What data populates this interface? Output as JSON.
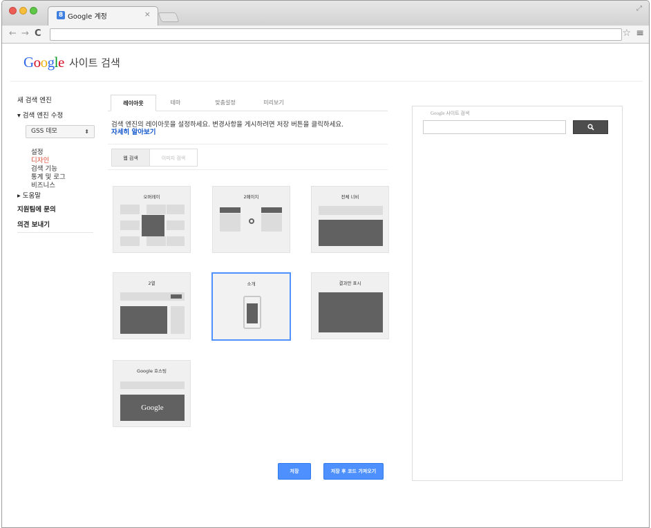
{
  "browser": {
    "tab_title": "Google 계정",
    "tab_close": "×",
    "favicon": "8",
    "url": "",
    "icons": {
      "back": "back-arrow-icon",
      "forward": "forward-arrow-icon",
      "reload": "reload-icon",
      "star": "star-icon",
      "menu": "menu-icon"
    }
  },
  "header": {
    "logo_letters": [
      "G",
      "o",
      "o",
      "g",
      "l",
      "e"
    ],
    "product_title": "사이트 검색"
  },
  "sidebar": {
    "new_engine": "새 검색 엔진",
    "edit_engine": "▾ 검색 엔진 수정",
    "engine_select": "GSS 데모",
    "engine_select_arrows": "⬍",
    "sub_items": [
      "설정",
      "디자인",
      "검색 기능",
      "통계 및 로그",
      "비즈니스"
    ],
    "active_sub": "디자인",
    "help": "▸ 도움말",
    "contact": "지원팀에 문의",
    "feedback": "의견 보내기"
  },
  "tabs": [
    {
      "label": "레이아웃",
      "active": true
    },
    {
      "label": "테마",
      "active": false
    },
    {
      "label": "맞춤설정",
      "active": false
    },
    {
      "label": "미리보기",
      "active": false
    }
  ],
  "description": "검색 엔진의 레이아웃을 설정하세요. 변경사항을 게시하려면 저장 버튼을 클릭하세요.",
  "learn_more": "자세히 알아보기",
  "search_type": {
    "web": "웹 검색",
    "image": "이미지 검색"
  },
  "layouts": [
    {
      "label": "오버레이",
      "selected": false
    },
    {
      "label": "2페이지",
      "selected": false
    },
    {
      "label": "전체 너비",
      "selected": false
    },
    {
      "label": "2열",
      "selected": false
    },
    {
      "label": "소개",
      "selected": true
    },
    {
      "label": "결과만 표시",
      "selected": false
    },
    {
      "label": "Google 호스팅",
      "selected": false
    }
  ],
  "hosted_logo": "Google",
  "buttons": {
    "save": "저장",
    "save_get_code": "저장 후 코드 가져오기"
  },
  "preview": {
    "title": "Google 사이트 검색",
    "search_icon": "search-icon"
  },
  "colors": {
    "accent": "#4d90fe",
    "active_nav": "#dd4b39",
    "link": "#1155cc"
  }
}
